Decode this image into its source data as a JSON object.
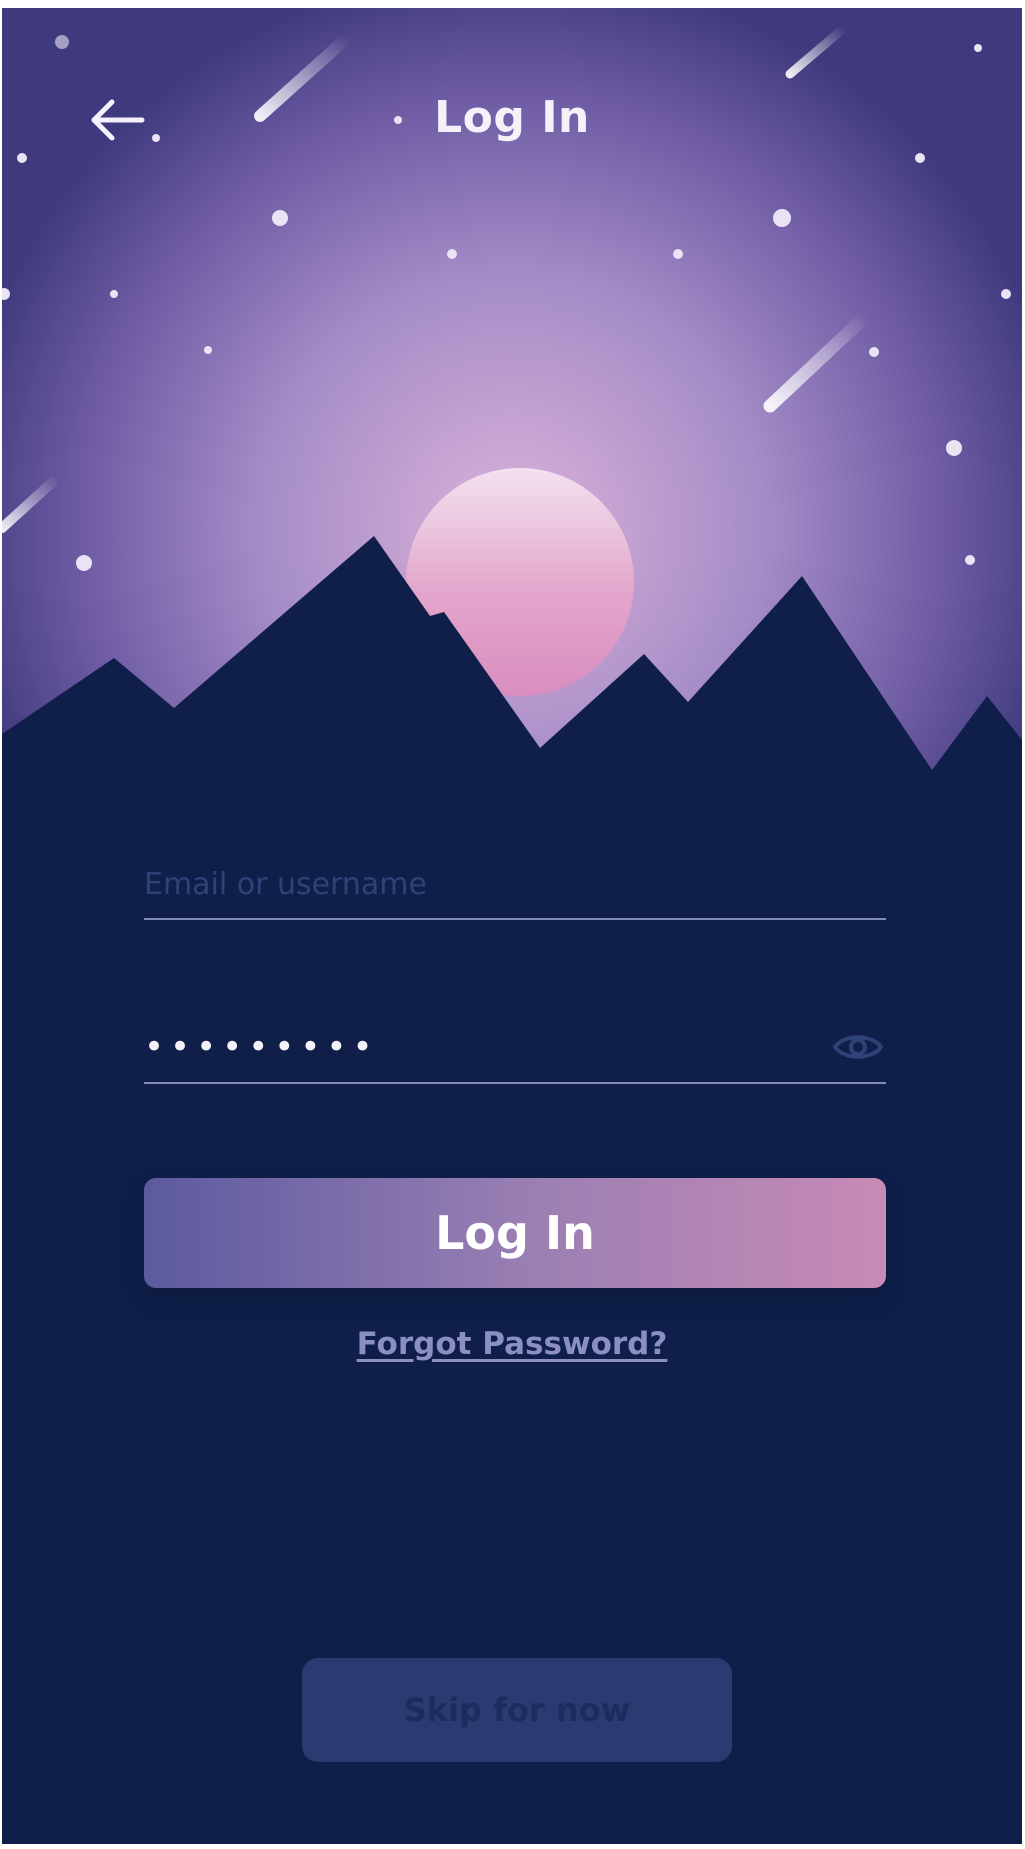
{
  "header": {
    "title": "Log In",
    "back_icon": "arrow-left-icon"
  },
  "form": {
    "email_placeholder": "Email or username",
    "password_value": "•••••••••",
    "eye_icon": "eye-icon"
  },
  "actions": {
    "login_label": "Log In",
    "forgot_label": "Forgot Password?",
    "skip_label": "Skip for now"
  },
  "colors": {
    "background": "#0f1f4a",
    "gradient_start": "#5c5aa0",
    "gradient_end": "#c88ab6",
    "moon": "#e6a8cf"
  }
}
